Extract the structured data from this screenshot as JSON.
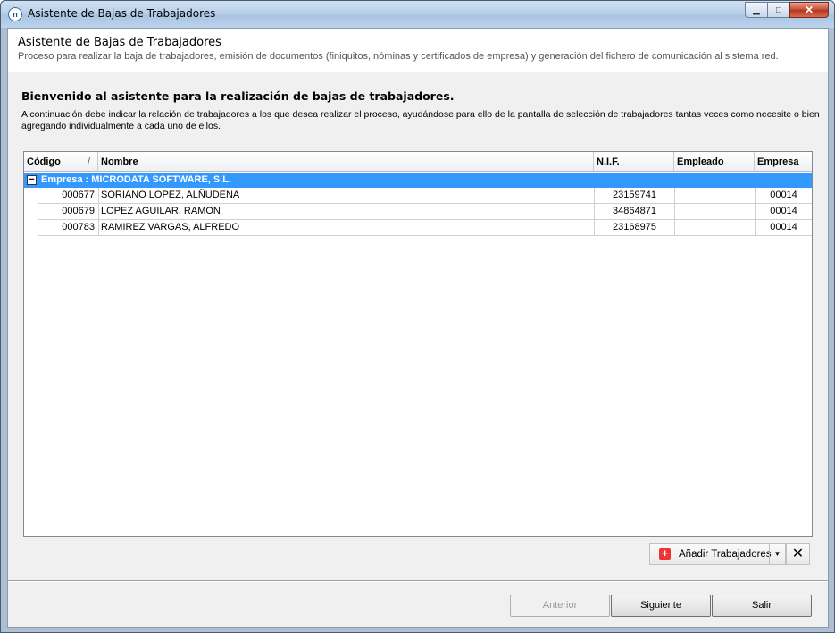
{
  "window": {
    "title": "Asistente de Bajas de Trabajadores",
    "icon_letter": "n",
    "controls": {
      "minimize": "▁",
      "maximize": "□",
      "close": "✕"
    }
  },
  "header": {
    "title": "Asistente de Bajas de Trabajadores",
    "subtitle": "Proceso para realizar la baja de trabajadores, emisión de documentos (finiquitos, nóminas y certificados de empresa) y generación del fichero de comunicación al sistema red."
  },
  "welcome": "Bienvenido al asistente para la realización de bajas de trabajadores.",
  "intro": "A continuación debe indicar la relación de trabajadores a los que desea realizar el proceso, ayudándose para ello de la pantalla de selección de trabajadores tantas veces como necesite o bien agregando individualmente a cada uno de ellos.",
  "grid": {
    "columns": [
      "Código",
      "Nombre",
      "N.I.F.",
      "Empleado",
      "Empresa"
    ],
    "sort_indicator": "/",
    "group_label": "Empresa : MICRODATA SOFTWARE, S.L.",
    "group_toggle": "−",
    "rows": [
      {
        "codigo": "000677",
        "nombre": "SORIANO LOPEZ, ALÑUDENA",
        "nif": "23159741",
        "empleado": "",
        "empresa": "00014"
      },
      {
        "codigo": "000679",
        "nombre": "LOPEZ AGUILAR, RAMON",
        "nif": "34864871",
        "empleado": "",
        "empresa": "00014"
      },
      {
        "codigo": "000783",
        "nombre": "RAMIREZ VARGAS, ALFREDO",
        "nif": "23168975",
        "empleado": "",
        "empresa": "00014"
      }
    ]
  },
  "actions": {
    "add_label": "Añadir Trabajadores",
    "add_icon": "+",
    "dropdown_icon": "▼",
    "delete_icon": "✕"
  },
  "nav": {
    "back": "Anterior",
    "next": "Siguiente",
    "exit": "Salir"
  }
}
